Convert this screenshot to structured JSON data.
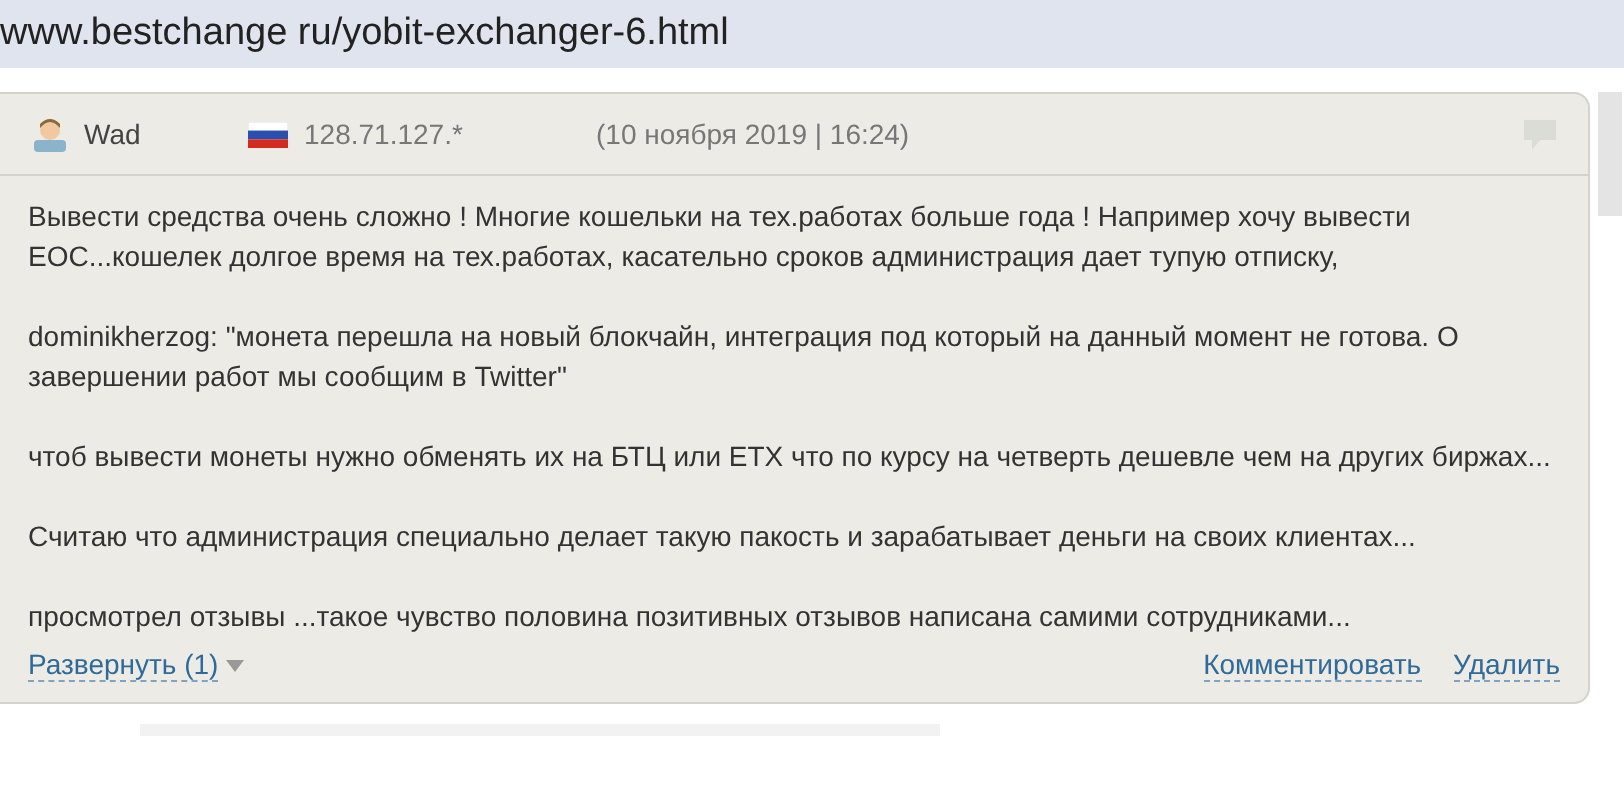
{
  "address_bar": {
    "url": "www.bestchange ru/yobit-exchanger-6.html"
  },
  "review": {
    "author": "Wad",
    "ip": "128.71.127.*",
    "date": "(10 ноября 2019 | 16:24)",
    "paragraphs": [
      "Вывести средства очень сложно ! Многие кошельки на тех.работах больше года ! Например хочу вывести ЕОС...кошелек долгое время на тех.работах, касательно сроков администрация дает тупую отписку,",
      "dominikherzog: \"монета перешла на новый блокчайн, интеграция под который на данный момент не готова. О завершении работ мы сообщим в Twitter\"",
      "чтоб вывести монеты нужно обменять их на БТЦ или ЕТХ что по курсу на четверть дешевле чем на других биржах...",
      "Считаю что администрация специально делает такую пакость и зарабатывает деньги на своих клиентах...",
      "просмотрел отзывы ...такое чувство половина позитивных отзывов написана самими сотрудниками..."
    ],
    "expand_link": "Развернуть (1)",
    "actions": [
      "Комментировать",
      "Удалить"
    ]
  }
}
